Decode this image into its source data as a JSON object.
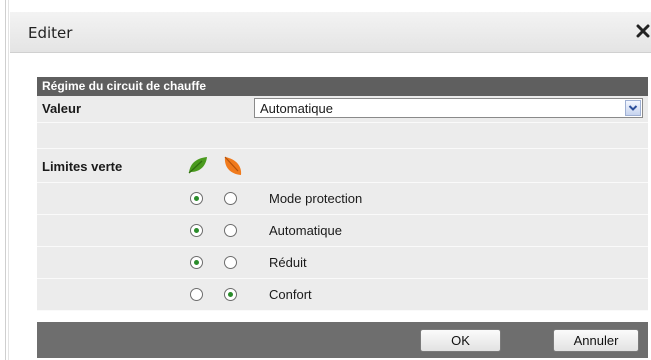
{
  "dialog": {
    "title": "Editer",
    "close_icon": "close-icon"
  },
  "section": {
    "header": "Régime du circuit de chauffe"
  },
  "valeur": {
    "label": "Valeur",
    "selected": "Automatique"
  },
  "limites": {
    "label": "Limites verte",
    "icons": [
      "green-leaf-icon",
      "orange-leaf-icon"
    ],
    "options": [
      {
        "label": "Mode protection",
        "green_selected": true,
        "orange_selected": false
      },
      {
        "label": "Automatique",
        "green_selected": true,
        "orange_selected": false
      },
      {
        "label": "Réduit",
        "green_selected": true,
        "orange_selected": false
      },
      {
        "label": "Confort",
        "green_selected": false,
        "orange_selected": true
      }
    ]
  },
  "buttons": {
    "ok": "OK",
    "cancel": "Annuler"
  },
  "colors": {
    "header_bg": "#5f5f5f",
    "row_bg": "#ececec",
    "footer_bg": "#6e6e6e",
    "radio_selected": "#2a8c2a",
    "leaf_green": "#4a9a1e",
    "leaf_orange": "#f07a1c"
  }
}
